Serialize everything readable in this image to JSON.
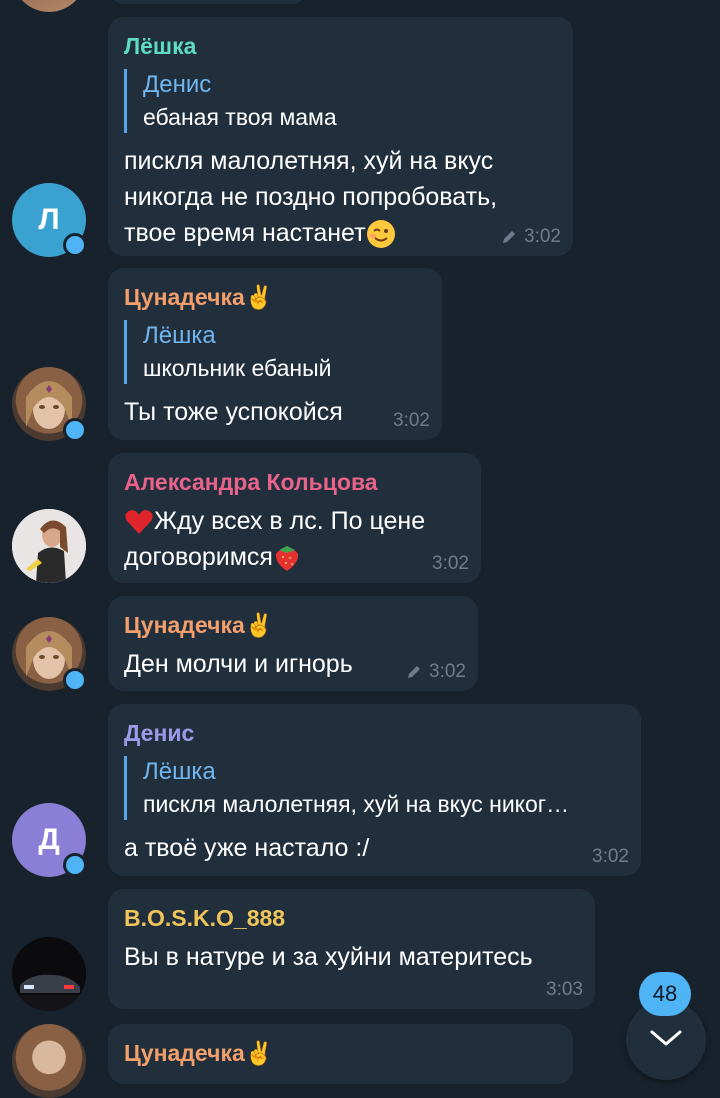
{
  "messages": [
    {
      "sender": "Лёшка",
      "sender_color": "#5ddbc6",
      "reply_name": "Денис",
      "reply_text": "ебаная твоя мама",
      "lines": [
        "пискля малолетняя, хуй на вкус",
        "никогда не поздно попробовать,",
        "твое время настанет"
      ],
      "emoji": "wink-emoji",
      "time": "3:02",
      "edited": true,
      "avatar_letter": "Л",
      "avatar_color": "#3aa2d0"
    },
    {
      "sender": "Цунадечка✌️",
      "sender_color": "#f29f6b",
      "reply_name": "Лёшка",
      "reply_text": "школьник ебаный",
      "lines": [
        "Ты тоже успокойся"
      ],
      "time": "3:02",
      "edited": false
    },
    {
      "sender": "Александра Кольцова",
      "sender_color": "#e8628a",
      "lines": [
        "Жду всех в лс. По цене",
        "договоримся"
      ],
      "time": "3:02",
      "edited": false
    },
    {
      "sender": "Цунадечка✌️",
      "sender_color": "#f29f6b",
      "lines": [
        "Ден молчи и игнорь"
      ],
      "time": "3:02",
      "edited": true
    },
    {
      "sender": "Денис",
      "sender_color": "#9d9ae8",
      "reply_name": "Лёшка",
      "reply_text": "пискля малолетняя, хуй на вкус никог…",
      "lines": [
        "а твоё уже настало :/"
      ],
      "time": "3:02",
      "edited": false,
      "avatar_letter": "Д",
      "avatar_color": "#8a7ed6"
    },
    {
      "sender": "B.O.S.K.O_888",
      "sender_color": "#efc55a",
      "lines": [
        "Вы в натуре и за хуйни материтесь"
      ],
      "time": "3:03",
      "edited": false
    },
    {
      "sender": "Цунадечка✌️",
      "sender_color": "#f29f6b"
    }
  ],
  "scroll": {
    "unread_count": "48"
  },
  "colors": {
    "background": "#18222d",
    "bubble": "#212f3d",
    "accent": "#4eb4f5"
  }
}
